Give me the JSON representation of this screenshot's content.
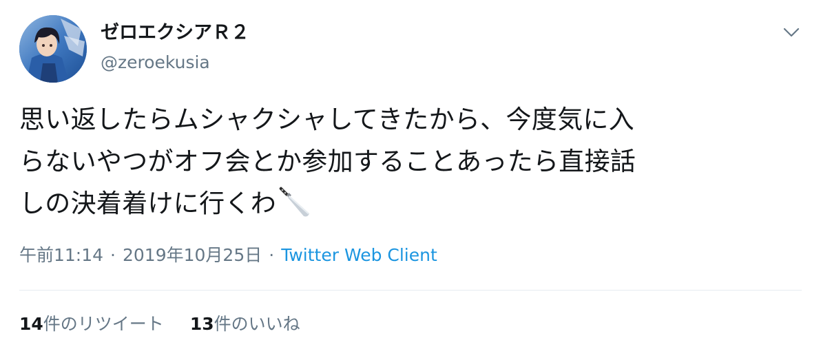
{
  "user": {
    "display_name": "ゼロエクシアＲ２",
    "handle": "@zeroekusia"
  },
  "tweet": {
    "lines": [
      "思い返したらムシャクシャしてきたから、今度気に入",
      "らないやつがオフ会とか参加することあったら直接話",
      "しの決着着けに行くわ"
    ],
    "emoji": "knife-icon"
  },
  "meta": {
    "time": "午前11:14",
    "separator": "·",
    "date": "2019年10月25日",
    "client": "Twitter Web Client"
  },
  "stats": {
    "retweet_count": "14",
    "retweet_label": "件のリツイート",
    "like_count": "13",
    "like_label": "件のいいね"
  },
  "colors": {
    "text": "#14171a",
    "secondary": "#657786",
    "link": "#1b95e0",
    "divider": "#e6ecf0"
  }
}
